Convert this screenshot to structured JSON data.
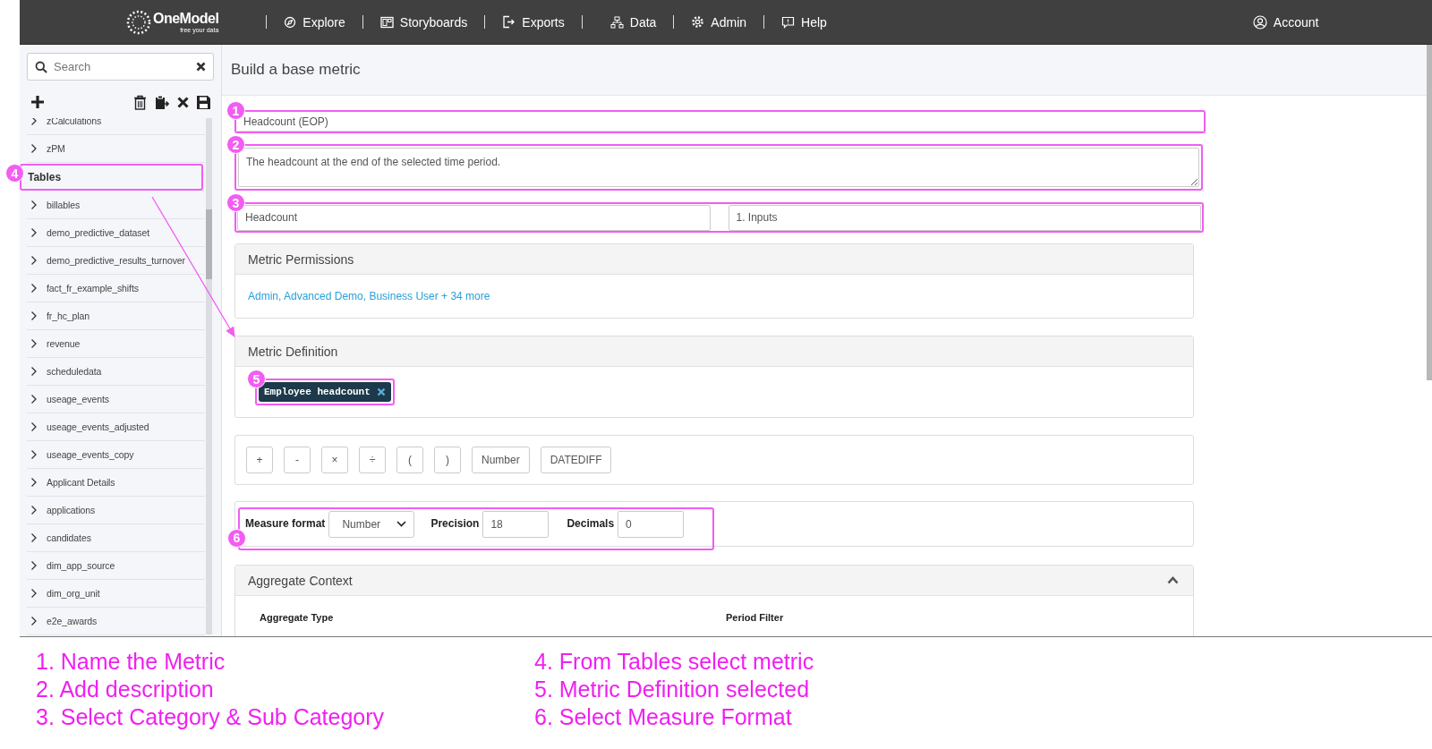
{
  "nav": {
    "logo": "OneModel",
    "tagline": "free your data",
    "items": [
      {
        "label": "Explore"
      },
      {
        "label": "Storyboards"
      },
      {
        "label": "Exports"
      },
      {
        "label": "Data"
      },
      {
        "label": "Admin"
      },
      {
        "label": "Help"
      }
    ],
    "account": "Account"
  },
  "sidebar": {
    "search": {
      "placeholder": "Search"
    },
    "items": [
      {
        "label": "zCalculations",
        "kind": "item"
      },
      {
        "label": "zPM",
        "kind": "item"
      },
      {
        "label": "Tables",
        "kind": "heading",
        "callout": "4"
      },
      {
        "label": "billables",
        "kind": "item"
      },
      {
        "label": "demo_predictive_dataset",
        "kind": "item"
      },
      {
        "label": "demo_predictive_results_turnover",
        "kind": "item"
      },
      {
        "label": "fact_fr_example_shifts",
        "kind": "item"
      },
      {
        "label": "fr_hc_plan",
        "kind": "item"
      },
      {
        "label": "revenue",
        "kind": "item"
      },
      {
        "label": "scheduledata",
        "kind": "item"
      },
      {
        "label": "useage_events",
        "kind": "item"
      },
      {
        "label": "useage_events_adjusted",
        "kind": "item"
      },
      {
        "label": "useage_events_copy",
        "kind": "item"
      },
      {
        "label": "Applicant Details",
        "kind": "item"
      },
      {
        "label": "applications",
        "kind": "item"
      },
      {
        "label": "candidates",
        "kind": "item"
      },
      {
        "label": "dim_app_source",
        "kind": "item"
      },
      {
        "label": "dim_org_unit",
        "kind": "item"
      },
      {
        "label": "e2e_awards",
        "kind": "item"
      }
    ]
  },
  "page_title": "Build a base metric",
  "name_field": {
    "value": "Headcount (EOP)",
    "callout": "1"
  },
  "description_field": {
    "value": "The headcount at the end of the selected time period.",
    "callout": "2"
  },
  "category_fields": {
    "category": "Headcount",
    "sub_category": "1. Inputs",
    "callout": "3"
  },
  "permissions": {
    "title": "Metric Permissions",
    "link": "Admin, Advanced Demo, Business User + 34 more"
  },
  "definition": {
    "title": "Metric Definition",
    "token": {
      "label": "Employee headcount",
      "callout": "5"
    }
  },
  "operators": [
    "+",
    "-",
    "×",
    "÷",
    "(",
    ")",
    "Number",
    "DATEDIFF"
  ],
  "format": {
    "callout": "6",
    "fields": [
      {
        "label": "Measure format",
        "value": "Number",
        "kind": "select"
      },
      {
        "label": "Precision",
        "value": "18",
        "kind": "input"
      },
      {
        "label": "Decimals",
        "value": "0",
        "kind": "input"
      }
    ]
  },
  "aggregate": {
    "title": "Aggregate Context",
    "expanded": true,
    "columns": [
      "Aggregate Type",
      "Period Filter"
    ]
  },
  "annotations": [
    {
      "text": "1. Name the Metric"
    },
    {
      "text": "2. Add description"
    },
    {
      "text": "3. Select Category & Sub Category"
    },
    {
      "text": "4. From Tables select metric"
    },
    {
      "text": "5. Metric Definition selected"
    },
    {
      "text": "6. Select Measure Format"
    }
  ]
}
